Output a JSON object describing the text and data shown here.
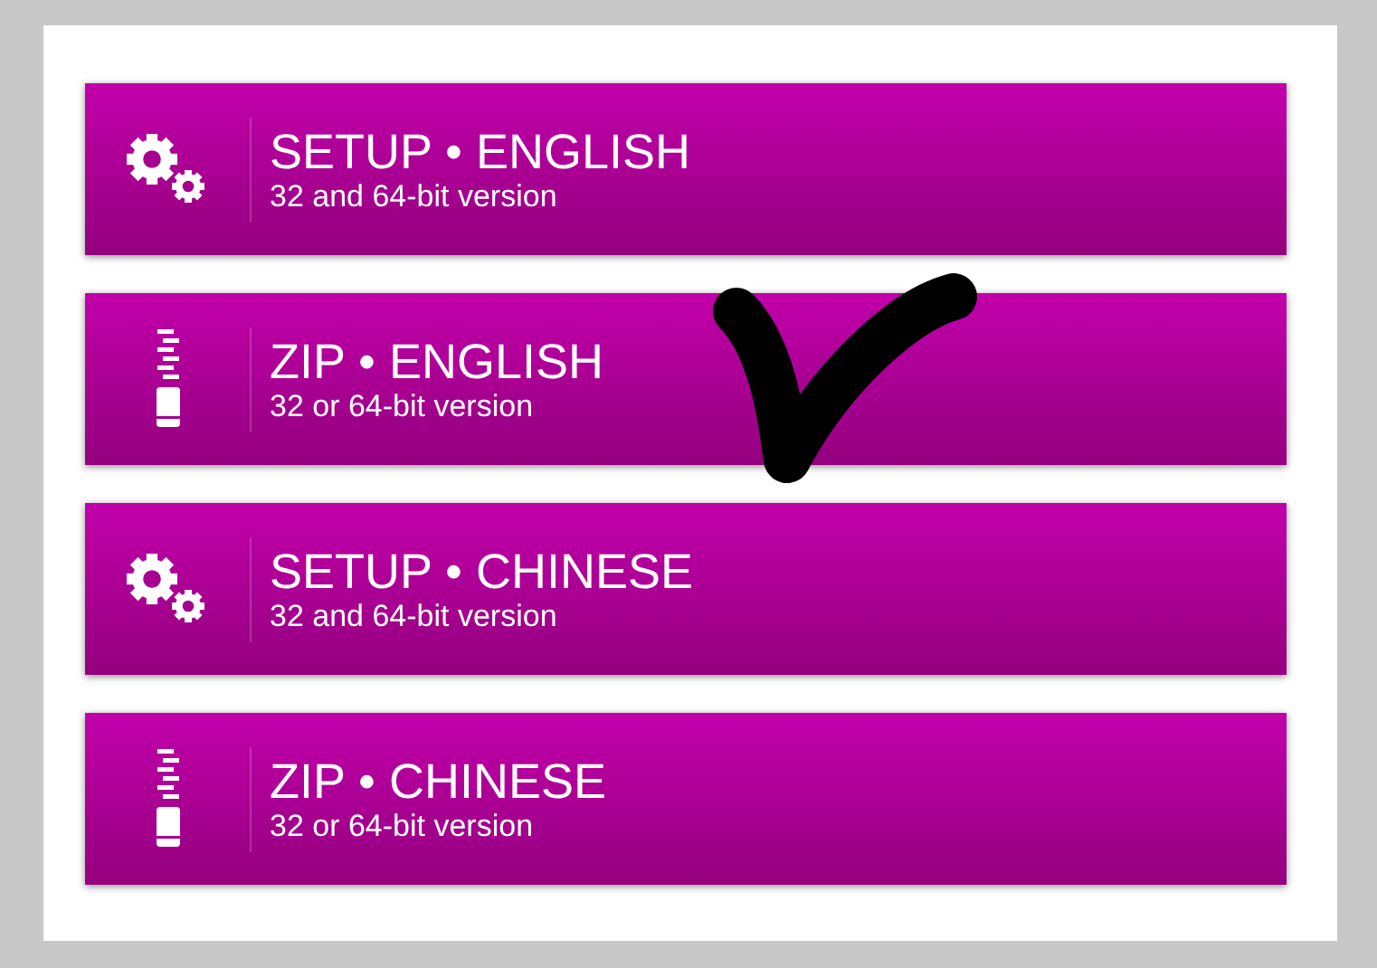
{
  "downloads": [
    {
      "kind": "setup",
      "title": "SETUP • ENGLISH",
      "subtitle": "32 and 64-bit version",
      "marked": false
    },
    {
      "kind": "zip",
      "title": "ZIP • ENGLISH",
      "subtitle": "32 or 64-bit version",
      "marked": true
    },
    {
      "kind": "setup",
      "title": "SETUP • CHINESE",
      "subtitle": "32 and 64-bit version",
      "marked": false
    },
    {
      "kind": "zip",
      "title": "ZIP • CHINESE",
      "subtitle": "32 or 64-bit version",
      "marked": false
    }
  ]
}
